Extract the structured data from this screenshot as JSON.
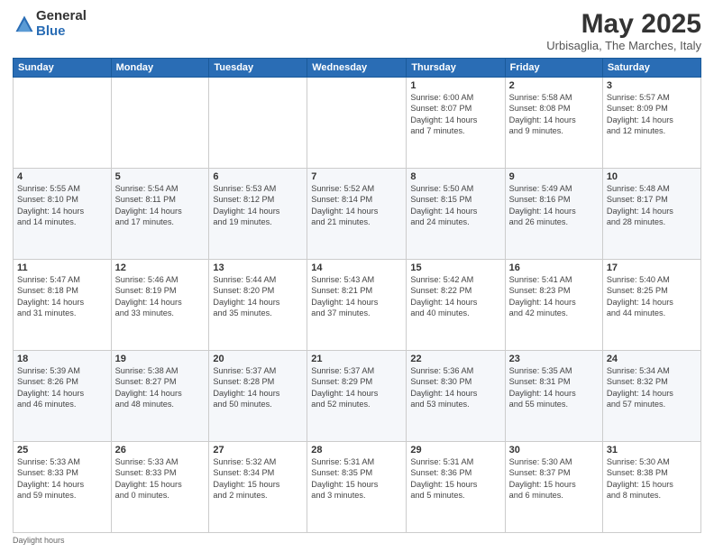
{
  "logo": {
    "general": "General",
    "blue": "Blue"
  },
  "header": {
    "title": "May 2025",
    "location": "Urbisaglia, The Marches, Italy"
  },
  "days_of_week": [
    "Sunday",
    "Monday",
    "Tuesday",
    "Wednesday",
    "Thursday",
    "Friday",
    "Saturday"
  ],
  "weeks": [
    [
      {
        "day": "",
        "info": ""
      },
      {
        "day": "",
        "info": ""
      },
      {
        "day": "",
        "info": ""
      },
      {
        "day": "",
        "info": ""
      },
      {
        "day": "1",
        "info": "Sunrise: 6:00 AM\nSunset: 8:07 PM\nDaylight: 14 hours\nand 7 minutes."
      },
      {
        "day": "2",
        "info": "Sunrise: 5:58 AM\nSunset: 8:08 PM\nDaylight: 14 hours\nand 9 minutes."
      },
      {
        "day": "3",
        "info": "Sunrise: 5:57 AM\nSunset: 8:09 PM\nDaylight: 14 hours\nand 12 minutes."
      }
    ],
    [
      {
        "day": "4",
        "info": "Sunrise: 5:55 AM\nSunset: 8:10 PM\nDaylight: 14 hours\nand 14 minutes."
      },
      {
        "day": "5",
        "info": "Sunrise: 5:54 AM\nSunset: 8:11 PM\nDaylight: 14 hours\nand 17 minutes."
      },
      {
        "day": "6",
        "info": "Sunrise: 5:53 AM\nSunset: 8:12 PM\nDaylight: 14 hours\nand 19 minutes."
      },
      {
        "day": "7",
        "info": "Sunrise: 5:52 AM\nSunset: 8:14 PM\nDaylight: 14 hours\nand 21 minutes."
      },
      {
        "day": "8",
        "info": "Sunrise: 5:50 AM\nSunset: 8:15 PM\nDaylight: 14 hours\nand 24 minutes."
      },
      {
        "day": "9",
        "info": "Sunrise: 5:49 AM\nSunset: 8:16 PM\nDaylight: 14 hours\nand 26 minutes."
      },
      {
        "day": "10",
        "info": "Sunrise: 5:48 AM\nSunset: 8:17 PM\nDaylight: 14 hours\nand 28 minutes."
      }
    ],
    [
      {
        "day": "11",
        "info": "Sunrise: 5:47 AM\nSunset: 8:18 PM\nDaylight: 14 hours\nand 31 minutes."
      },
      {
        "day": "12",
        "info": "Sunrise: 5:46 AM\nSunset: 8:19 PM\nDaylight: 14 hours\nand 33 minutes."
      },
      {
        "day": "13",
        "info": "Sunrise: 5:44 AM\nSunset: 8:20 PM\nDaylight: 14 hours\nand 35 minutes."
      },
      {
        "day": "14",
        "info": "Sunrise: 5:43 AM\nSunset: 8:21 PM\nDaylight: 14 hours\nand 37 minutes."
      },
      {
        "day": "15",
        "info": "Sunrise: 5:42 AM\nSunset: 8:22 PM\nDaylight: 14 hours\nand 40 minutes."
      },
      {
        "day": "16",
        "info": "Sunrise: 5:41 AM\nSunset: 8:23 PM\nDaylight: 14 hours\nand 42 minutes."
      },
      {
        "day": "17",
        "info": "Sunrise: 5:40 AM\nSunset: 8:25 PM\nDaylight: 14 hours\nand 44 minutes."
      }
    ],
    [
      {
        "day": "18",
        "info": "Sunrise: 5:39 AM\nSunset: 8:26 PM\nDaylight: 14 hours\nand 46 minutes."
      },
      {
        "day": "19",
        "info": "Sunrise: 5:38 AM\nSunset: 8:27 PM\nDaylight: 14 hours\nand 48 minutes."
      },
      {
        "day": "20",
        "info": "Sunrise: 5:37 AM\nSunset: 8:28 PM\nDaylight: 14 hours\nand 50 minutes."
      },
      {
        "day": "21",
        "info": "Sunrise: 5:37 AM\nSunset: 8:29 PM\nDaylight: 14 hours\nand 52 minutes."
      },
      {
        "day": "22",
        "info": "Sunrise: 5:36 AM\nSunset: 8:30 PM\nDaylight: 14 hours\nand 53 minutes."
      },
      {
        "day": "23",
        "info": "Sunrise: 5:35 AM\nSunset: 8:31 PM\nDaylight: 14 hours\nand 55 minutes."
      },
      {
        "day": "24",
        "info": "Sunrise: 5:34 AM\nSunset: 8:32 PM\nDaylight: 14 hours\nand 57 minutes."
      }
    ],
    [
      {
        "day": "25",
        "info": "Sunrise: 5:33 AM\nSunset: 8:33 PM\nDaylight: 14 hours\nand 59 minutes."
      },
      {
        "day": "26",
        "info": "Sunrise: 5:33 AM\nSunset: 8:33 PM\nDaylight: 15 hours\nand 0 minutes."
      },
      {
        "day": "27",
        "info": "Sunrise: 5:32 AM\nSunset: 8:34 PM\nDaylight: 15 hours\nand 2 minutes."
      },
      {
        "day": "28",
        "info": "Sunrise: 5:31 AM\nSunset: 8:35 PM\nDaylight: 15 hours\nand 3 minutes."
      },
      {
        "day": "29",
        "info": "Sunrise: 5:31 AM\nSunset: 8:36 PM\nDaylight: 15 hours\nand 5 minutes."
      },
      {
        "day": "30",
        "info": "Sunrise: 5:30 AM\nSunset: 8:37 PM\nDaylight: 15 hours\nand 6 minutes."
      },
      {
        "day": "31",
        "info": "Sunrise: 5:30 AM\nSunset: 8:38 PM\nDaylight: 15 hours\nand 8 minutes."
      }
    ]
  ],
  "footer": {
    "note": "Daylight hours"
  }
}
